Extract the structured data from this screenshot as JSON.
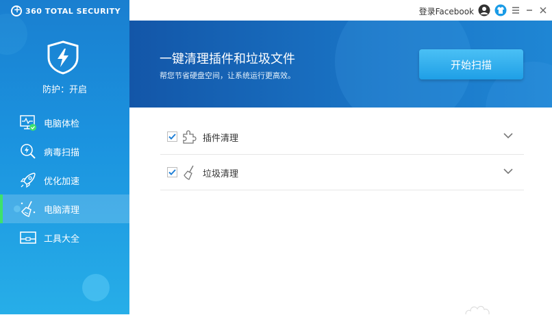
{
  "app": {
    "brand": "360 TOTAL SECURITY"
  },
  "sidebar": {
    "protection_status": "防护：开启",
    "items": [
      {
        "label": "电脑体检",
        "icon": "monitor-check-icon"
      },
      {
        "label": "病毒扫描",
        "icon": "virus-scan-icon"
      },
      {
        "label": "优化加速",
        "icon": "rocket-icon"
      },
      {
        "label": "电脑清理",
        "icon": "broom-icon"
      },
      {
        "label": "工具大全",
        "icon": "toolbox-icon"
      }
    ]
  },
  "topbar": {
    "login_label": "登录Facebook"
  },
  "banner": {
    "title": "一键清理插件和垃圾文件",
    "subtitle": "帮您节省硬盘空间，让系统运行更高效。",
    "scan_button": "开始扫描"
  },
  "clean_items": [
    {
      "label": "插件清理",
      "checked": true,
      "icon": "puzzle-icon"
    },
    {
      "label": "垃圾清理",
      "checked": true,
      "icon": "brush-icon"
    }
  ],
  "colors": {
    "accent": "#1f9fe6",
    "sidebar": "#1b8ad8",
    "active_bar": "#3de26c"
  }
}
